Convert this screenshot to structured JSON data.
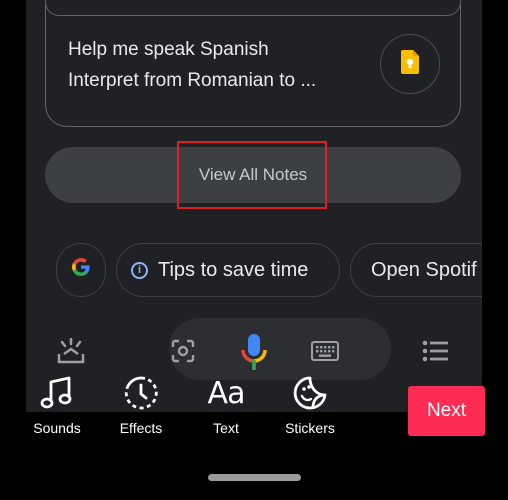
{
  "notes_card": {
    "line1": "Help me speak Spanish",
    "line2": "Interpret from Romanian to ..."
  },
  "view_all_label": "View All Notes",
  "chips": [
    {
      "label": "",
      "icon": "google-icon"
    },
    {
      "label": "Tips to save time",
      "icon": "info-icon"
    },
    {
      "label": "Open Spotif",
      "icon": ""
    }
  ],
  "assistant_bar": {
    "icons": [
      "snapshot-icon",
      "lens-icon",
      "mic-icon",
      "keyboard-icon",
      "list-icon"
    ]
  },
  "tools": {
    "sounds": "Sounds",
    "effects": "Effects",
    "text": "Text",
    "text_icon": "Aa",
    "stickers": "Stickers"
  },
  "next_label": "Next",
  "colors": {
    "next": "#fe2c55",
    "highlight": "#e02020",
    "mic_blue": "#4285f4",
    "mic_red": "#ea4335",
    "mic_yellow": "#fbbc04",
    "mic_green": "#34a853"
  }
}
